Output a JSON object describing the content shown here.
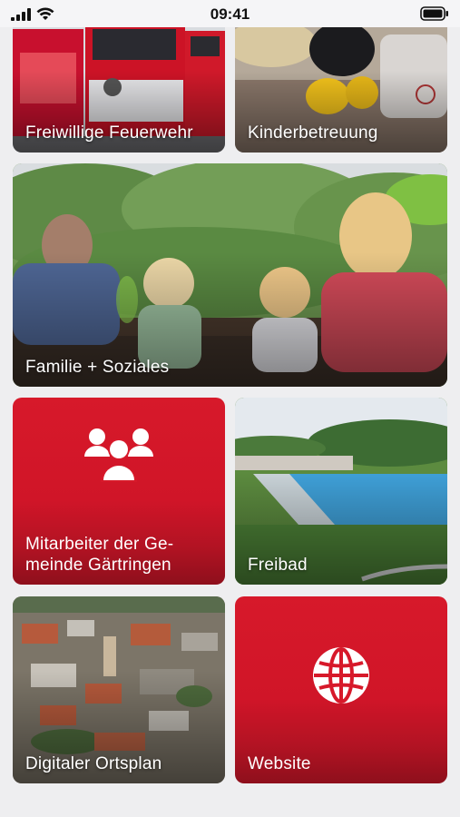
{
  "status": {
    "time": "09:41",
    "icons": [
      "signal-icon",
      "wifi-icon",
      "battery-icon"
    ]
  },
  "tiles": [
    {
      "label": "Freiwillige Feuerwehr",
      "kind": "photo",
      "icon": "fire-truck-photo"
    },
    {
      "label": "Kinderbetreuung",
      "kind": "photo",
      "icon": "toy-photo"
    },
    {
      "label": "Familie + Soziales",
      "kind": "photo",
      "icon": "family-photo"
    },
    {
      "label": "Mitarbeiter der Ge-\nmeinde Gärtringen",
      "kind": "icon",
      "icon": "people-icon"
    },
    {
      "label": "Freibad",
      "kind": "photo",
      "icon": "pool-photo"
    },
    {
      "label": "Digitaler Ortsplan",
      "kind": "photo",
      "icon": "town-photo"
    },
    {
      "label": "Website",
      "kind": "icon",
      "icon": "globe-icon"
    }
  ],
  "colors": {
    "accent": "#d7192a",
    "background": "#eeeef0"
  }
}
